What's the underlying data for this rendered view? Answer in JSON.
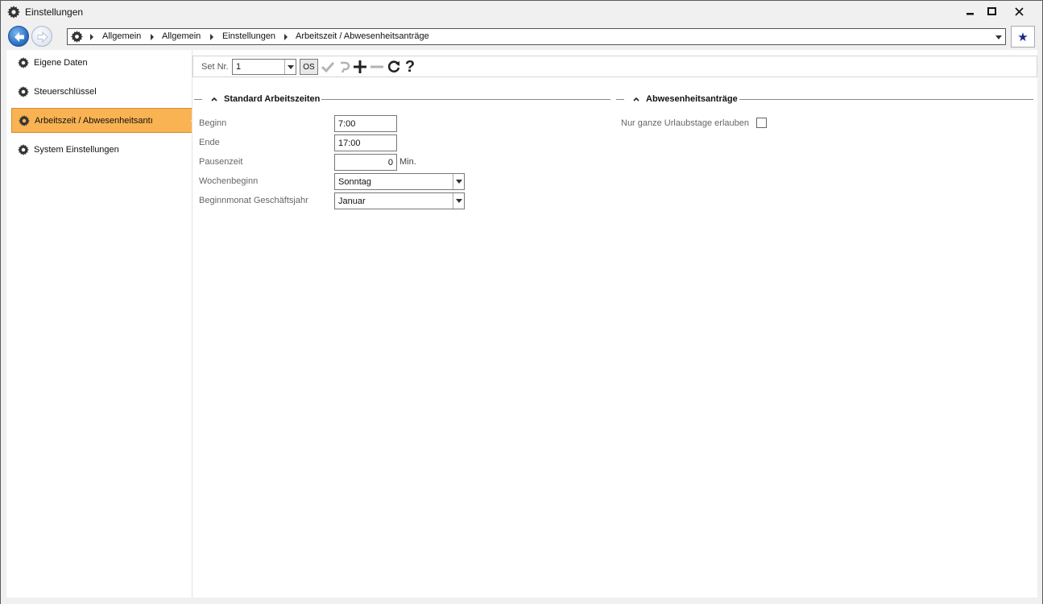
{
  "window": {
    "title": "Einstellungen"
  },
  "navigation": {
    "breadcrumbs": [
      "Allgemein",
      "Allgemein",
      "Einstellungen",
      "Arbeitszeit / Abwesenheitsanträge"
    ]
  },
  "sidebar": {
    "items": [
      {
        "label": "Eigene Daten"
      },
      {
        "label": "Steuerschlüssel"
      },
      {
        "label": "Arbeitszeit / Abwesenheitsantı"
      },
      {
        "label": "System Einstellungen"
      }
    ],
    "active_index": 2,
    "active_color": "#f9b352"
  },
  "toolbar": {
    "set_label": "Set Nr.",
    "set_value": "1",
    "os_label": "OS",
    "icons": [
      "check-icon",
      "undo-icon",
      "plus-icon",
      "minus-icon",
      "refresh-icon",
      "help-icon"
    ],
    "help_glyph": "?"
  },
  "standard": {
    "title": "Standard Arbeitszeiten",
    "beginn_label": "Beginn",
    "beginn_value": "7:00",
    "ende_label": "Ende",
    "ende_value": "17:00",
    "pause_label": "Pausenzeit",
    "pause_value": "0",
    "pause_unit": "Min.",
    "wochen_label": "Wochenbeginn",
    "wochen_value": "Sonntag",
    "monat_label": "Beginnmonat Geschäftsjahr",
    "monat_value": "Januar"
  },
  "absence": {
    "title": "Abwesenheitsanträge",
    "urlaub_label": "Nur ganze Urlaubstage erlauben",
    "urlaub_checked": false
  }
}
